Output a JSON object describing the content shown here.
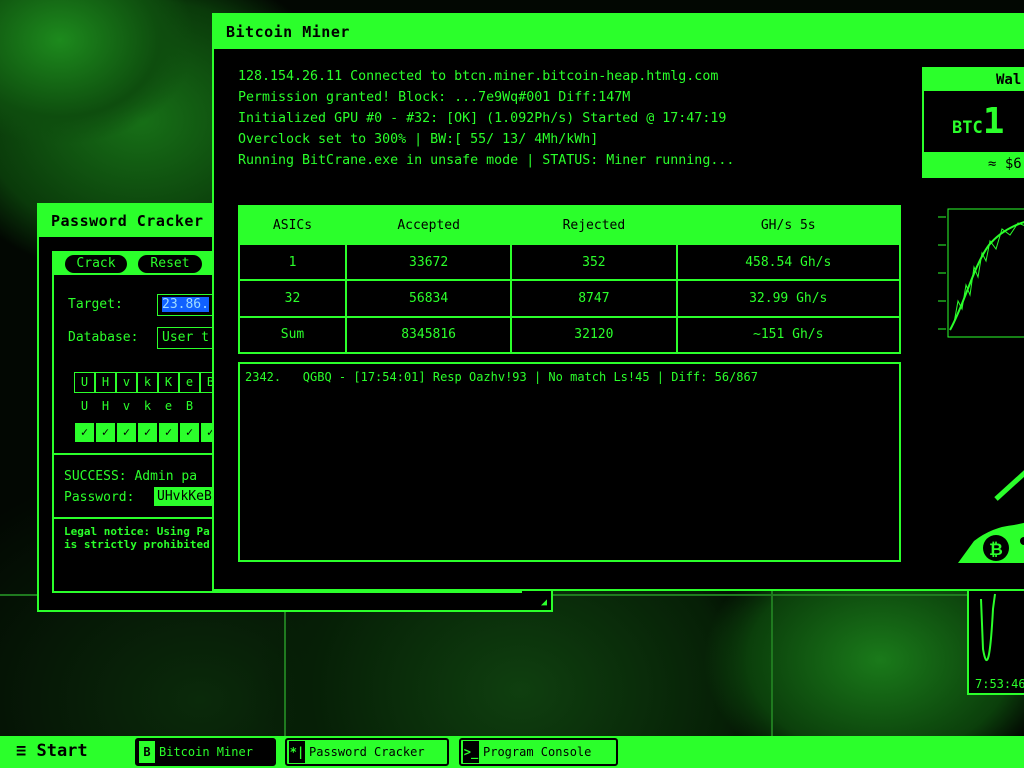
{
  "password_cracker": {
    "title": "Password Cracker",
    "buttons": {
      "crack": "Crack",
      "reset": "Reset"
    },
    "target_label": "Target:",
    "target_value": "23.86.",
    "database_label": "Database:",
    "database_value": "User t",
    "chars": [
      "U",
      "H",
      "v",
      "k",
      "K",
      "e",
      "B"
    ],
    "chars_plain": [
      "U",
      "H",
      "v",
      "k",
      "e",
      "B"
    ],
    "success_line": "SUCCESS: Admin pa",
    "password_label": "Password:",
    "password_value": "UHvkKeB",
    "legal_1": "Legal notice: Using Pa",
    "legal_2": "is strictly prohibited a"
  },
  "bitcoin_miner": {
    "title": "Bitcoin Miner",
    "log": [
      "128.154.26.11 Connected to btcn.miner.bitcoin-heap.htmlg.com",
      "Permission granted! Block: ...7e9Wq#001 Diff:147M",
      "Initialized GPU #0 - #32: [OK] (1.092Ph/s) Started @ 17:47:19",
      "Overclock set to 300% | BW:[ 55/ 13/ 4Mh/kWh]",
      "Running BitCrane.exe in unsafe mode | STATUS: Miner running..."
    ],
    "table": {
      "headers": [
        "ASICs",
        "Accepted",
        "Rejected",
        "GH/s 5s"
      ],
      "rows": [
        [
          "1",
          "33672",
          "352",
          "458.54 Gh/s"
        ],
        [
          "32",
          "56834",
          "8747",
          "32.99 Gh/s"
        ],
        [
          "Sum",
          "8345816",
          "32120",
          "~151 Gh/s"
        ]
      ]
    },
    "console_line": "2342.   QGBQ - [17:54:01] Resp Oazhv!93 | No match Ls!45 | Diff: 56/867",
    "wallet": {
      "title": "Wal",
      "currency": "BTC",
      "amount": "1",
      "usd": "≈ $6"
    }
  },
  "side_timestamp": "7:53:46",
  "taskbar": {
    "start": "≡ Start",
    "items": [
      {
        "icon": "B",
        "label": "Bitcoin Miner"
      },
      {
        "icon": "*|",
        "label": "Password Cracker"
      },
      {
        "icon": ">_",
        "label": "Program Console"
      }
    ]
  },
  "colors": {
    "accent": "#2bff2b",
    "background": "#000000",
    "selection": "#1060ff"
  }
}
